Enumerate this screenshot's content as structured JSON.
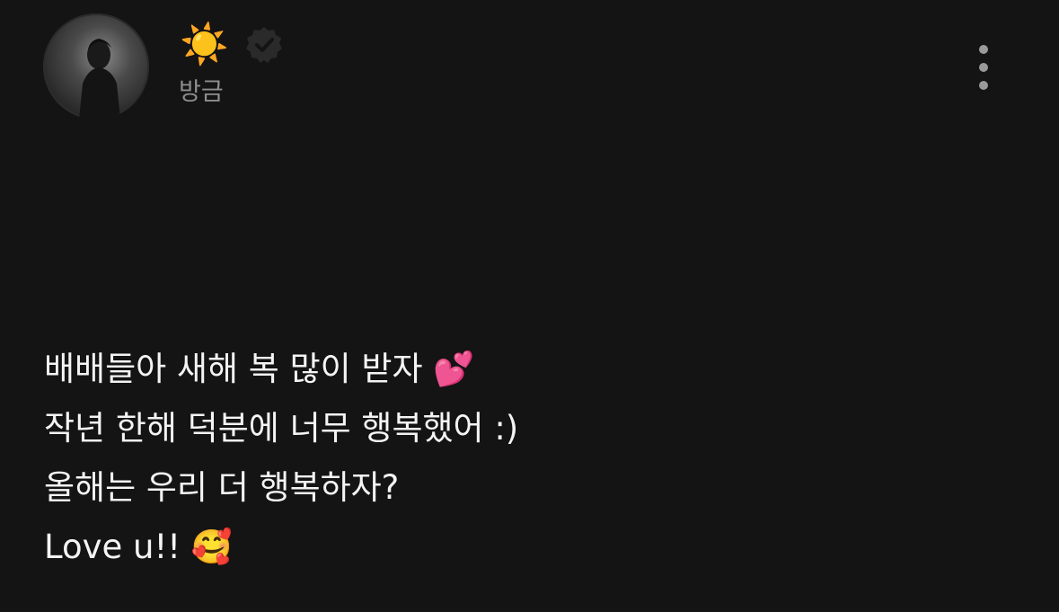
{
  "header": {
    "username": "☀️",
    "verified_badge": "verified-check-icon",
    "timestamp": "방금",
    "more_menu": "more-vertical-icon"
  },
  "post": {
    "lines": [
      "배배들아 새해 복 많이 받자 💕",
      "작년 한해 덕분에 너무 행복했어 :)",
      "올해는 우리 더 행복하자?",
      "Love u!! 🥰"
    ]
  },
  "colors": {
    "background": "#141414",
    "text": "#f4f4f4",
    "muted": "#8e8e8e",
    "badge": "#2a2a2a"
  }
}
